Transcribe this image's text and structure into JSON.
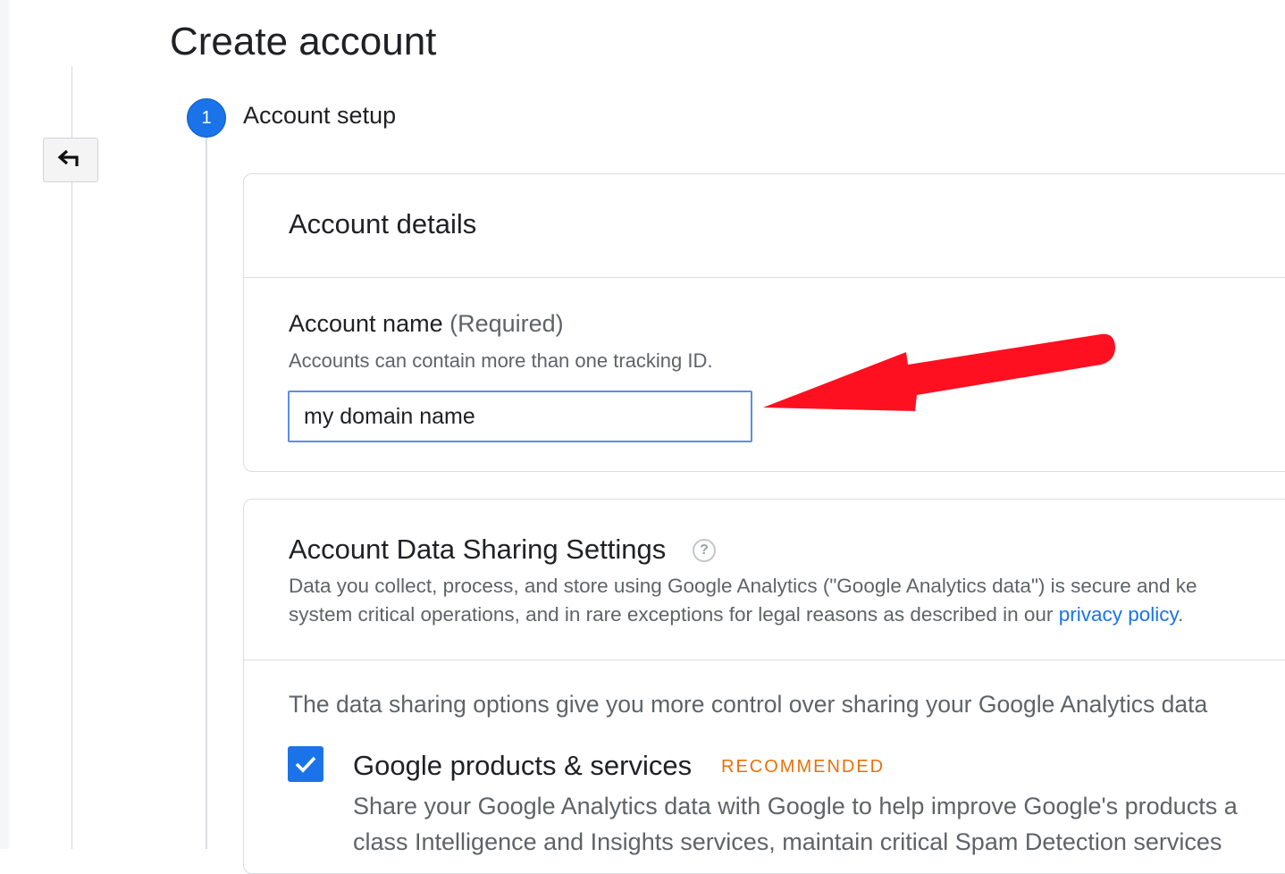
{
  "page": {
    "title": "Create account"
  },
  "step": {
    "number": "1",
    "label": "Account setup"
  },
  "account_details": {
    "title": "Account details",
    "field_label": "Account name",
    "field_required": "(Required)",
    "field_hint": "Accounts can contain more than one tracking ID.",
    "field_value": "my domain name"
  },
  "data_sharing": {
    "title": "Account Data Sharing Settings",
    "desc_line1": "Data you collect, process, and store using Google Analytics (\"Google Analytics data\") is secure and ke",
    "desc_line2_prefix": "system critical operations, and in rare exceptions for legal reasons as described in our ",
    "privacy_link": "privacy policy",
    "desc_line2_suffix": ".",
    "intro": "The data sharing options give you more control over sharing your Google Analytics data",
    "option": {
      "title": "Google products & services",
      "badge": "RECOMMENDED",
      "checked": true,
      "desc_line1": "Share your Google Analytics data with Google to help improve Google's products a",
      "desc_line2": "class Intelligence and Insights services, maintain critical Spam Detection services"
    }
  },
  "icons": {
    "back": "back-arrow-icon",
    "help": "help-circle-icon",
    "check": "checkmark-icon",
    "annotation": "red-arrow-annotation"
  },
  "colors": {
    "primary": "#1a73e8",
    "badge": "#e8710a",
    "annotation": "#ff1020"
  }
}
